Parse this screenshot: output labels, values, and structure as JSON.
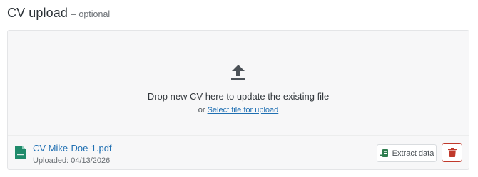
{
  "header": {
    "title": "CV upload",
    "optional_label": "– optional"
  },
  "dropzone": {
    "icon": "upload-icon",
    "instruction": "Drop new CV here to update the existing file",
    "or_text": "or",
    "select_link": "Select file for upload"
  },
  "file": {
    "icon": "document-icon",
    "name": "CV-Mike-Doe-1.pdf",
    "uploaded": "Uploaded: 04/13/2026"
  },
  "actions": {
    "extract_label": "Extract data",
    "extract_icon": "data-extract-icon",
    "delete_icon": "trash-icon"
  },
  "colors": {
    "link": "#1f6fb2",
    "delete": "#c0392b",
    "extract": "#2e7d4f",
    "file_icon": "#1f8a6a"
  }
}
